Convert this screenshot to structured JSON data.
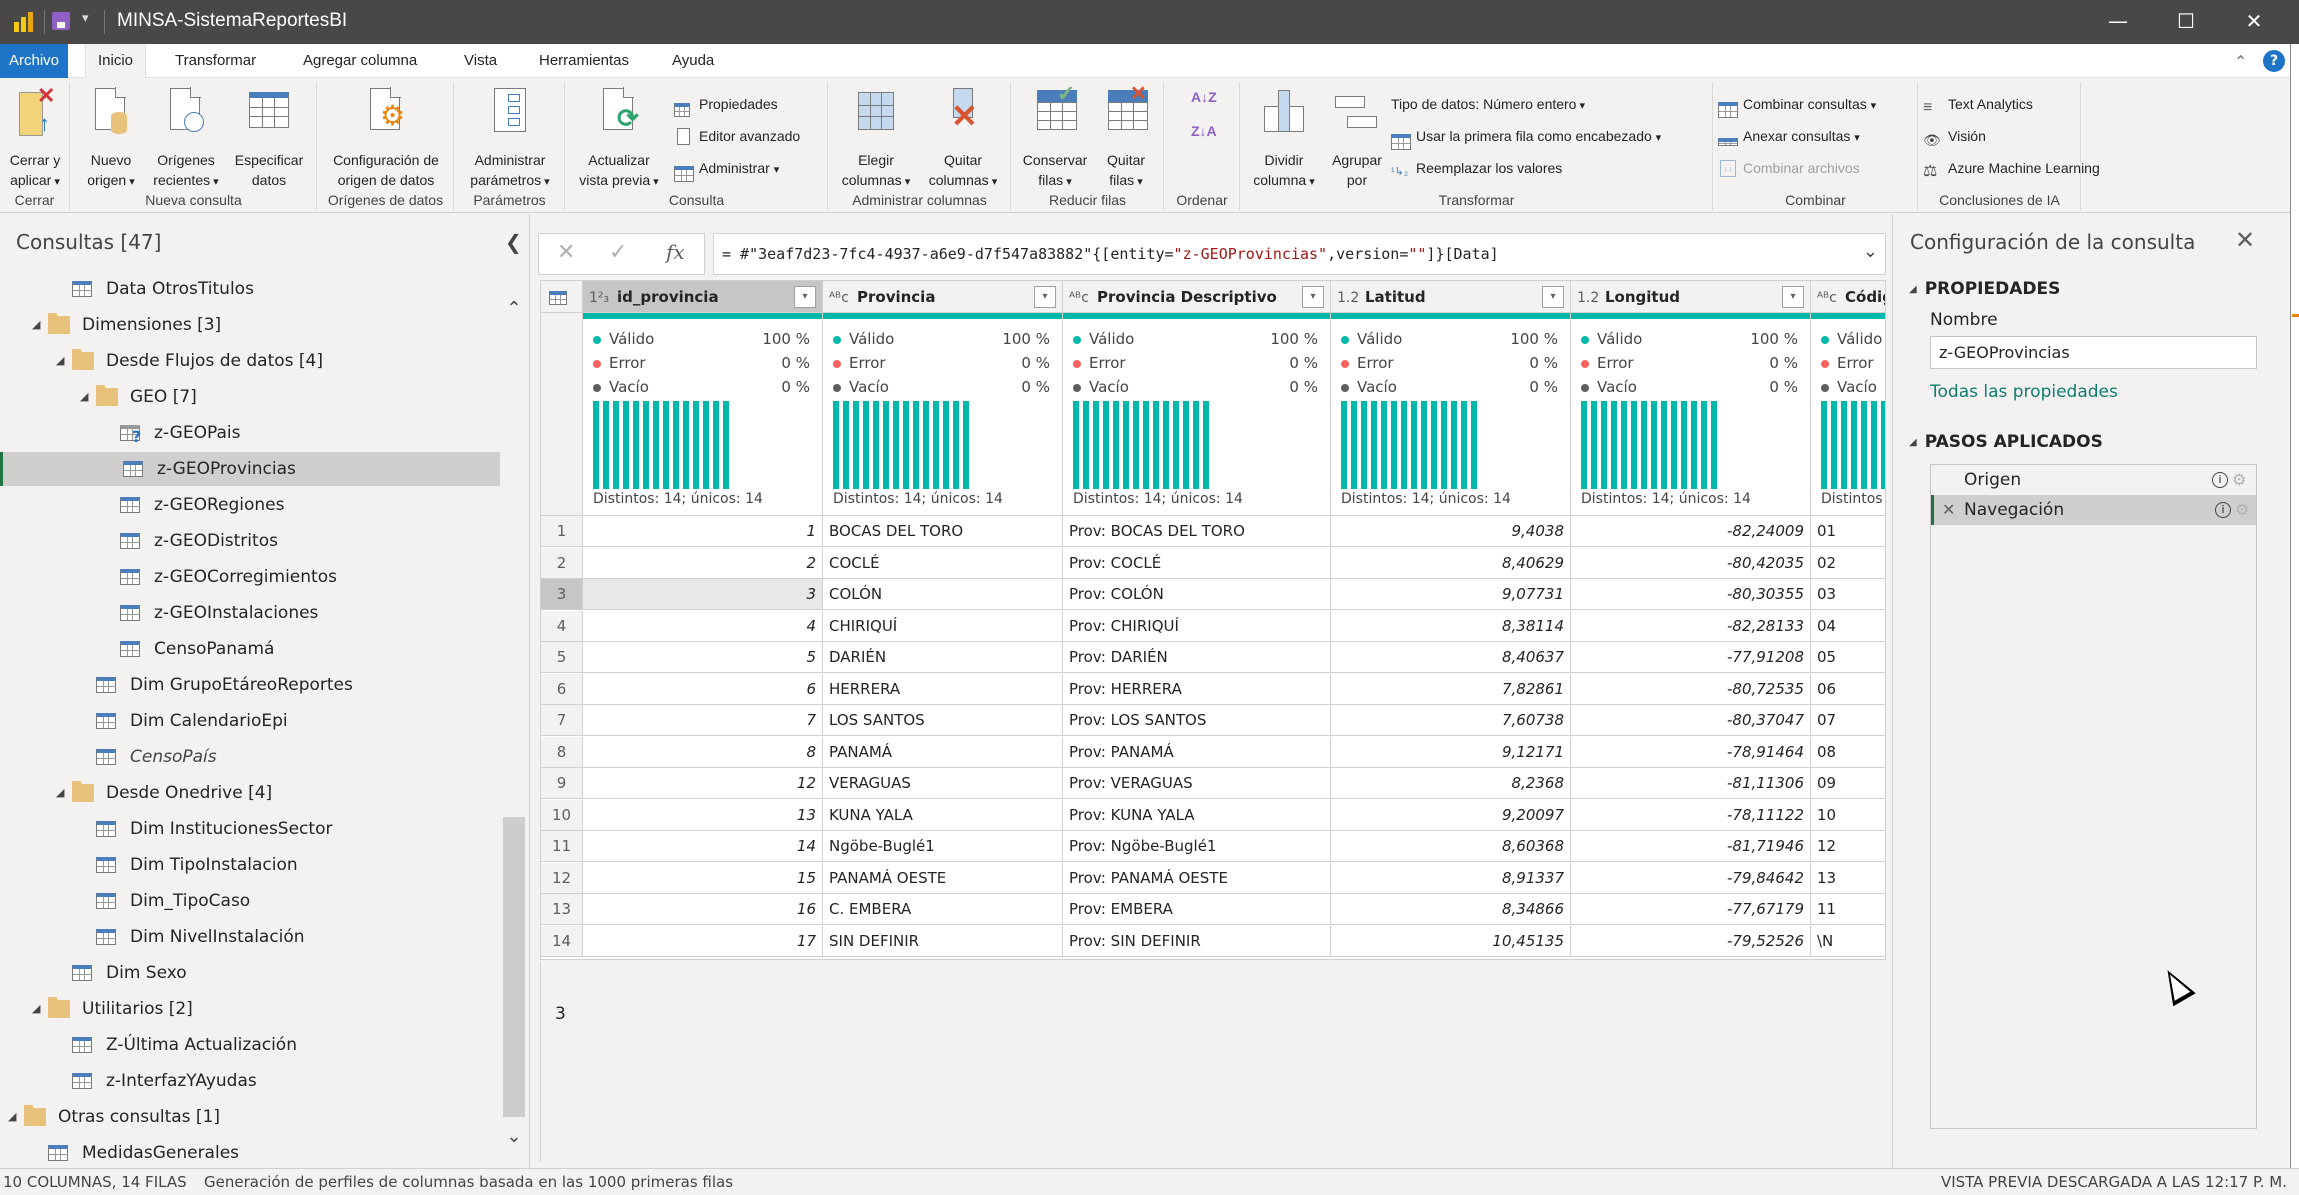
{
  "window": {
    "title": "MINSA-SistemaReportesBI",
    "controls": {
      "minimize": "—",
      "maximize": "☐",
      "close": "✕"
    }
  },
  "menu": {
    "tabs": [
      "Archivo",
      "Inicio",
      "Transformar",
      "Agregar columna",
      "Vista",
      "Herramientas",
      "Ayuda"
    ],
    "active": "Inicio",
    "help": "?"
  },
  "ribbon": {
    "groups": {
      "cerrar": {
        "label": "Cerrar",
        "close_apply": [
          "Cerrar y",
          "aplicar"
        ]
      },
      "nueva_consulta": {
        "label": "Nueva consulta",
        "nuevo_origen": [
          "Nuevo",
          "origen"
        ],
        "origenes_recientes": [
          "Orígenes",
          "recientes"
        ],
        "especificar_datos": [
          "Especificar",
          "datos"
        ]
      },
      "origenes": {
        "label": "Orígenes de datos",
        "config": [
          "Configuración de",
          "origen de datos"
        ]
      },
      "parametros": {
        "label": "Parámetros",
        "admin": [
          "Administrar",
          "parámetros"
        ]
      },
      "consulta": {
        "label": "Consulta",
        "actualizar": [
          "Actualizar",
          "vista previa"
        ],
        "propiedades": "Propiedades",
        "editor": "Editor avanzado",
        "administrar": "Administrar"
      },
      "admin_columnas": {
        "label": "Administrar columnas",
        "elegir": [
          "Elegir",
          "columnas"
        ],
        "quitar": [
          "Quitar",
          "columnas"
        ]
      },
      "reducir_filas": {
        "label": "Reducir filas",
        "conservar": [
          "Conservar",
          "filas"
        ],
        "quitar": [
          "Quitar",
          "filas"
        ]
      },
      "ordenar": {
        "label": "Ordenar",
        "az": "A↓Z",
        "za": "Z↓A"
      },
      "transformar": {
        "label": "Transformar",
        "dividir": [
          "Dividir",
          "columna"
        ],
        "agrupar": [
          "Agrupar",
          "por"
        ],
        "tipo_datos": "Tipo de datos: Número entero",
        "primera_fila": "Usar la primera fila como encabezado",
        "reemplazar": "Reemplazar los valores"
      },
      "combinar": {
        "label": "Combinar",
        "combinar_consultas": "Combinar consultas",
        "anexar": "Anexar consultas",
        "combinar_archivos": "Combinar archivos"
      },
      "ia": {
        "label": "Conclusiones de IA",
        "text_analytics": "Text Analytics",
        "vision": "Visión",
        "azure_ml": "Azure Machine Learning"
      }
    }
  },
  "queries": {
    "title": "Consultas [47]",
    "items": [
      {
        "label": "Data OtrosTitulos",
        "type": "table",
        "level": 2
      },
      {
        "label": "Dimensiones [3]",
        "type": "folder",
        "level": 1
      },
      {
        "label": "Desde Flujos de datos [4]",
        "type": "folder",
        "level": 2
      },
      {
        "label": "GEO [7]",
        "type": "folder",
        "level": 3
      },
      {
        "label": "z-GEOPais",
        "type": "table-warning",
        "level": 4
      },
      {
        "label": "z-GEOProvincias",
        "type": "table",
        "level": 4,
        "selected": true
      },
      {
        "label": "z-GEORegiones",
        "type": "table",
        "level": 4
      },
      {
        "label": "z-GEODistritos",
        "type": "table",
        "level": 4
      },
      {
        "label": "z-GEOCorregimientos",
        "type": "table",
        "level": 4
      },
      {
        "label": "z-GEOInstalaciones",
        "type": "table",
        "level": 4
      },
      {
        "label": "CensoPanamá",
        "type": "table",
        "level": 4
      },
      {
        "label": "Dim GrupoEtáreoReportes",
        "type": "table",
        "level": 3
      },
      {
        "label": "Dim CalendarioEpi",
        "type": "table",
        "level": 3
      },
      {
        "label": "CensoPaís",
        "type": "table",
        "level": 3,
        "italic": true
      },
      {
        "label": "Desde Onedrive [4]",
        "type": "folder",
        "level": 2
      },
      {
        "label": "Dim InstitucionesSector",
        "type": "table",
        "level": 3
      },
      {
        "label": "Dim TipoInstalacion",
        "type": "table",
        "level": 3
      },
      {
        "label": "Dim_TipoCaso",
        "type": "table",
        "level": 3
      },
      {
        "label": "Dim NivelInstalación",
        "type": "table",
        "level": 3
      },
      {
        "label": "Dim Sexo",
        "type": "table",
        "level": 2
      },
      {
        "label": "Utilitarios [2]",
        "type": "folder",
        "level": 1
      },
      {
        "label": "Z-Última Actualización",
        "type": "table",
        "level": 2
      },
      {
        "label": "z-InterfazYAyudas",
        "type": "table",
        "level": 2
      },
      {
        "label": "Otras consultas [1]",
        "type": "folder",
        "level": 0
      },
      {
        "label": "MedidasGenerales",
        "type": "table",
        "level": 1
      }
    ]
  },
  "formula": {
    "prefix": "= #\"3eaf7d23-7fc4-4937-a6e9-d7f547a83882\"{[entity=",
    "entity": "\"z-GEOProvincias\"",
    "middle": ",version=",
    "version": "\"\"",
    "suffix": "]}[Data]"
  },
  "grid": {
    "columns": [
      {
        "name": "id_provincia",
        "type": "1²₃",
        "align": "num"
      },
      {
        "name": "Provincia",
        "type": "ᴬᴮc",
        "align": "text"
      },
      {
        "name": "Provincia Descriptivo",
        "type": "ᴬᴮc",
        "align": "text"
      },
      {
        "name": "Latitud",
        "type": "1.2",
        "align": "num"
      },
      {
        "name": "Longitud",
        "type": "1.2",
        "align": "num"
      },
      {
        "name": "Códig",
        "type": "ᴬᴮc",
        "align": "text"
      }
    ],
    "profile": {
      "valid_label": "Válido",
      "valid_pct": "100 %",
      "error_label": "Error",
      "error_pct": "0 %",
      "empty_label": "Vacío",
      "empty_pct": "0 %",
      "distinct_text": "Distintos: 14; únicos: 14",
      "distinct_cut": "Distintos",
      "histogram_bars": 14
    },
    "rows": [
      [
        "1",
        "BOCAS DEL TORO",
        "Prov: BOCAS DEL TORO",
        "9,4038",
        "-82,24009",
        "01"
      ],
      [
        "2",
        "COCLÉ",
        "Prov: COCLÉ",
        "8,40629",
        "-80,42035",
        "02"
      ],
      [
        "3",
        "COLÓN",
        "Prov: COLÓN",
        "9,07731",
        "-80,30355",
        "03"
      ],
      [
        "4",
        "CHIRIQUÍ",
        "Prov: CHIRIQUÍ",
        "8,38114",
        "-82,28133",
        "04"
      ],
      [
        "5",
        "DARIÉN",
        "Prov: DARIÉN",
        "8,40637",
        "-77,91208",
        "05"
      ],
      [
        "6",
        "HERRERA",
        "Prov: HERRERA",
        "7,82861",
        "-80,72535",
        "06"
      ],
      [
        "7",
        "LOS SANTOS",
        "Prov: LOS SANTOS",
        "7,60738",
        "-80,37047",
        "07"
      ],
      [
        "8",
        "PANAMÁ",
        "Prov: PANAMÁ",
        "9,12171",
        "-78,91464",
        "08"
      ],
      [
        "12",
        "VERAGUAS",
        "Prov: VERAGUAS",
        "8,2368",
        "-81,11306",
        "09"
      ],
      [
        "13",
        "KUNA YALA",
        "Prov: KUNA YALA",
        "9,20097",
        "-78,11122",
        "10"
      ],
      [
        "14",
        "Ngöbe-Buglé1",
        "Prov: Ngöbe-Buglé1",
        "8,60368",
        "-81,71946",
        "12"
      ],
      [
        "15",
        "PANAMÁ OESTE",
        "Prov: PANAMÁ OESTE",
        "8,91337",
        "-79,84642",
        "13"
      ],
      [
        "16",
        "C. EMBERA",
        "Prov: EMBERA",
        "8,34866",
        "-77,67179",
        "11"
      ],
      [
        "17",
        "SIN DEFINIR",
        "Prov: SIN DEFINIR",
        "10,45135",
        "-79,52526",
        "\\N"
      ]
    ],
    "selected_row": 3,
    "selected_value": "3"
  },
  "settings": {
    "title": "Configuración de la consulta",
    "properties_header": "PROPIEDADES",
    "name_label": "Nombre",
    "name_value": "z-GEOProvincias",
    "all_properties": "Todas las propiedades",
    "steps_header": "PASOS APLICADOS",
    "steps": [
      {
        "label": "Origen",
        "selected": false
      },
      {
        "label": "Navegación",
        "selected": true
      }
    ]
  },
  "status": {
    "counts": "10 COLUMNAS, 14 FILAS",
    "profiling": "Generación de perfiles de columnas basada en las 1000 primeras filas",
    "preview": "VISTA PREVIA DESCARGADA A LAS 12:17 P. M."
  },
  "colors": {
    "accent_teal": "#01b8aa",
    "error_red": "#fd625e",
    "empty_gray": "#605e5c",
    "file_tab_blue": "#1e74c6",
    "selection_green": "#217346",
    "link_teal": "#107c6f"
  }
}
